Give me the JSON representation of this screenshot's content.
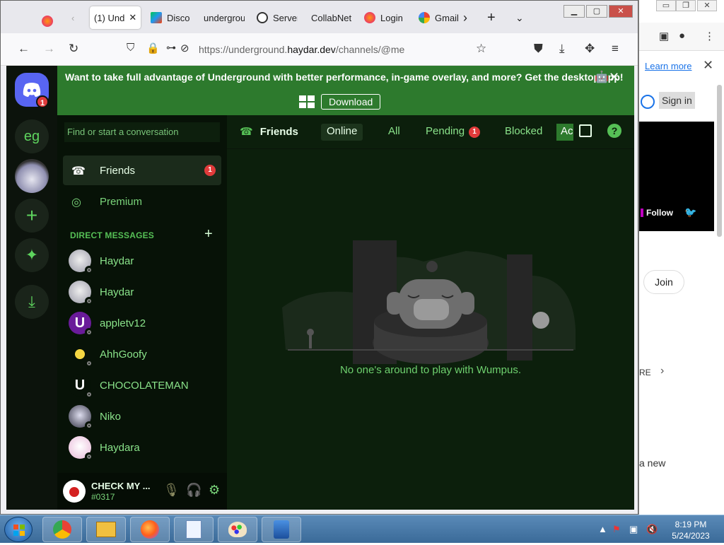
{
  "bg_window": {
    "controls": [
      "▭",
      "❐",
      "✕"
    ],
    "learn_more": "Learn more",
    "sign_in": "Sign in",
    "follow": "Follow",
    "join": "Join",
    "re_text": "RE",
    "new_text": "a new"
  },
  "browser": {
    "tabs": [
      {
        "label": "(1) Und",
        "icon": "discord-favicon",
        "active": true
      },
      {
        "label": "Disco",
        "icon": "google-play-favicon"
      },
      {
        "label": "undergrou",
        "icon": "none"
      },
      {
        "label": "Server",
        "icon": "info-favicon"
      },
      {
        "label": "CollabNet",
        "icon": "none"
      },
      {
        "label": "Login",
        "icon": "firefox-favicon"
      },
      {
        "label": "Gmail",
        "icon": "google-favicon"
      }
    ],
    "url_prefix": "https://underground.",
    "url_domain": "haydar.dev",
    "url_path": "/channels/@me"
  },
  "discord": {
    "servers": [
      {
        "label": "",
        "badge": "1",
        "icon": "discord-logo"
      },
      {
        "label": "eg"
      },
      {
        "label": "",
        "icon": "avatar-anime"
      },
      {
        "label": "+",
        "icon": "add-server-icon"
      },
      {
        "label": "",
        "icon": "compass-icon"
      },
      {
        "label": "",
        "icon": "download-icon"
      }
    ],
    "banner": {
      "text": "Want to take full advantage of Underground with better performance, in-game overlay, and more? Get the desktop app!",
      "download": "Download"
    },
    "search_placeholder": "Find or start a conversation",
    "friends_label": "Friends",
    "friends_badge": "1",
    "premium_label": "Premium",
    "dm_header": "DIRECT MESSAGES",
    "dms": [
      "Haydar",
      "Haydar",
      "appletv12",
      "AhhGoofy",
      "CHOCOLATEMAN",
      "Niko",
      "Haydara"
    ],
    "user": {
      "name": "CHECK MY ...",
      "tag": "#0317"
    },
    "header": {
      "title": "Friends",
      "tabs": [
        "Online",
        "All",
        "Pending",
        "Blocked"
      ],
      "pending_badge": "1",
      "add_friend": "Ac"
    },
    "empty_text": "No one's around to play with Wumpus."
  },
  "taskbar": {
    "time": "8:19 PM",
    "date": "5/24/2023"
  },
  "colors": {
    "accent": "#2d7a2d",
    "text_green": "#8ae38a",
    "badge": "#e03b3b",
    "bg": "#0c1f0c"
  }
}
